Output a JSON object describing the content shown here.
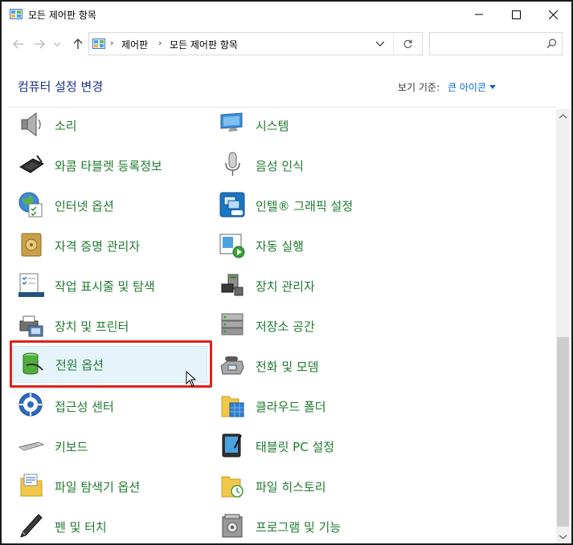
{
  "window": {
    "title": "모든 제어판 항목"
  },
  "address": {
    "crumbs": [
      "제어판",
      "모든 제어판 항목"
    ],
    "sep": "›"
  },
  "search": {
    "placeholder": ""
  },
  "header": {
    "heading": "컴퓨터 설정 변경",
    "view_by_label": "보기 기준:",
    "view_by_value": "큰 아이콘"
  },
  "items": {
    "left": [
      {
        "label": "소리",
        "icon": "speaker-icon"
      },
      {
        "label": "와콤 타블렛 등록정보",
        "icon": "tablet-pen-icon"
      },
      {
        "label": "인터넷 옵션",
        "icon": "globe-check-icon"
      },
      {
        "label": "자격 증명 관리자",
        "icon": "vault-icon"
      },
      {
        "label": "작업 표시줄 및 탐색",
        "icon": "taskbar-icon"
      },
      {
        "label": "장치 및 프린터",
        "icon": "printer-icon"
      },
      {
        "label": "전원 옵션",
        "icon": "battery-icon"
      },
      {
        "label": "접근성 센터",
        "icon": "ease-of-access-icon"
      },
      {
        "label": "키보드",
        "icon": "keyboard-icon"
      },
      {
        "label": "파일 탐색기 옵션",
        "icon": "folder-options-icon"
      },
      {
        "label": "펜 및 터치",
        "icon": "pen-icon"
      }
    ],
    "right": [
      {
        "label": "시스템",
        "icon": "monitor-icon"
      },
      {
        "label": "음성 인식",
        "icon": "microphone-icon"
      },
      {
        "label": "인텔® 그래픽 설정",
        "icon": "intel-graphics-icon"
      },
      {
        "label": "자동 실행",
        "icon": "autoplay-icon"
      },
      {
        "label": "장치 관리자",
        "icon": "device-manager-icon"
      },
      {
        "label": "저장소 공간",
        "icon": "storage-icon"
      },
      {
        "label": "전화 및 모뎀",
        "icon": "phone-icon"
      },
      {
        "label": "클라우드 폴더",
        "icon": "cloud-folder-icon"
      },
      {
        "label": "태블릿 PC 설정",
        "icon": "tablet-pc-icon"
      },
      {
        "label": "파일 히스토리",
        "icon": "file-history-icon"
      },
      {
        "label": "프로그램 및 기능",
        "icon": "programs-icon"
      }
    ]
  },
  "colors": {
    "link_green": "#1e7a2e",
    "heading_blue": "#1e3287",
    "accent_blue": "#0066cc",
    "highlight_red": "#e0201c"
  }
}
